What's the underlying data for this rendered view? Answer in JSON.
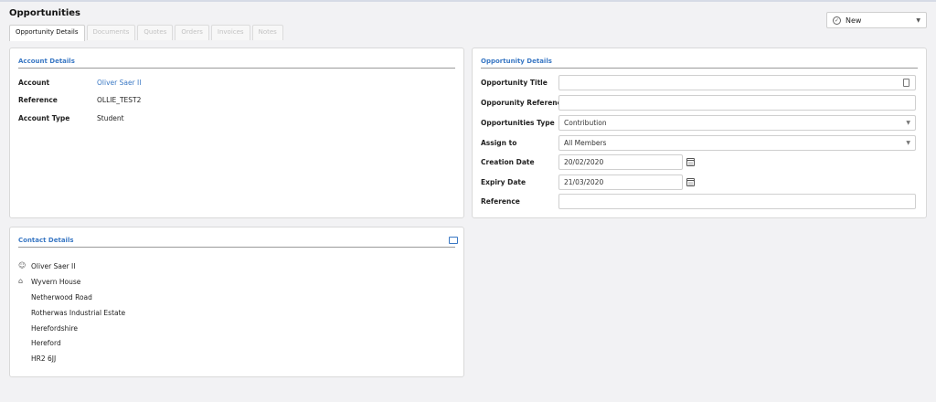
{
  "header": {
    "title": "Opportunities",
    "status_select": {
      "value": "New"
    }
  },
  "tabs": [
    {
      "label": "Opportunity Details",
      "active": true
    },
    {
      "label": "Documents",
      "active": false
    },
    {
      "label": "Quotes",
      "active": false
    },
    {
      "label": "Orders",
      "active": false
    },
    {
      "label": "Invoices",
      "active": false
    },
    {
      "label": "Notes",
      "active": false
    }
  ],
  "account": {
    "title": "Account Details",
    "rows": [
      {
        "label": "Account",
        "value": "Oliver Saer II"
      },
      {
        "label": "Reference",
        "value": "OLLIE_TEST2"
      },
      {
        "label": "Account Type",
        "value": "Student"
      }
    ]
  },
  "opportunity": {
    "title": "Opportunity Details",
    "fields": [
      {
        "label": "Opportunity Title",
        "value": ""
      },
      {
        "label": "Opporunity Reference",
        "value": ""
      },
      {
        "label": "Opportunities Type",
        "value": "Contribution"
      },
      {
        "label": "Assign to",
        "value": "All Members"
      },
      {
        "label": "Creation Date",
        "value": "20/02/2020"
      },
      {
        "label": "Expiry Date",
        "value": "21/03/2020"
      },
      {
        "label": "Reference",
        "value": ""
      }
    ]
  },
  "contact": {
    "title": "Contact Details",
    "name": "Oliver Saer II",
    "address": [
      "Wyvern House",
      "Netherwood Road",
      "Rotherwas Industrial Estate",
      "Herefordshire",
      "Hereford",
      "HR2 6JJ"
    ]
  },
  "colors": {
    "accent": "#3a78c4",
    "background": "#f2f2f4"
  }
}
